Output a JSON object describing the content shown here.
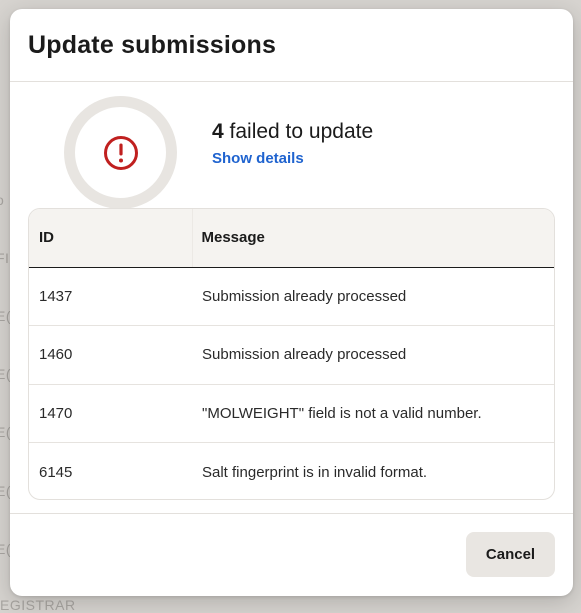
{
  "background": {
    "fragments": [
      "o",
      "FI",
      "E(",
      "E(",
      "E(",
      "E(",
      "E(",
      "EGISTRAR"
    ]
  },
  "dialog": {
    "title": "Update submissions",
    "summary": {
      "failed_count": "4",
      "failed_text": " failed to update",
      "details_link": "Show details",
      "icon": "alert-circle-icon",
      "icon_color": "#c0201f"
    },
    "table": {
      "headers": [
        "ID",
        "Message"
      ],
      "rows": [
        {
          "id": "1437",
          "message": "Submission already processed"
        },
        {
          "id": "1460",
          "message": "Submission already processed"
        },
        {
          "id": "1470",
          "message": "\"MOLWEIGHT\" field is not a valid number."
        },
        {
          "id": "6145",
          "message": "Salt fingerprint is in invalid format."
        }
      ]
    },
    "footer": {
      "cancel_label": "Cancel"
    }
  },
  "colors": {
    "link": "#1f63cf",
    "error": "#c0201f",
    "surface": "#ffffff",
    "header_bg": "#f5f3f0"
  }
}
